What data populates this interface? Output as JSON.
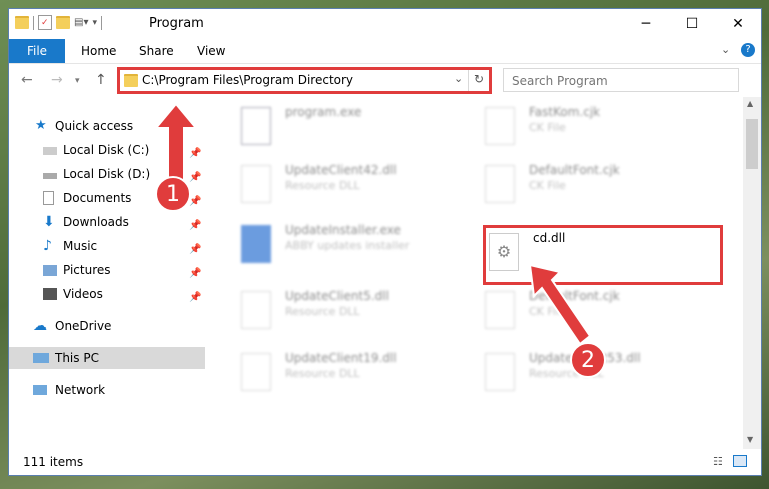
{
  "window": {
    "title": "Program",
    "minimize": "─",
    "maximize": "☐",
    "close": "✕"
  },
  "ribbon": {
    "file": "File",
    "home": "Home",
    "share": "Share",
    "view": "View"
  },
  "address": {
    "path": "C:\\Program Files\\Program Directory",
    "search_placeholder": "Search Program"
  },
  "nav": {
    "items": [
      {
        "label": "Quick access"
      },
      {
        "label": "Local Disk (C:)"
      },
      {
        "label": "Local Disk (D:)"
      },
      {
        "label": "Documents"
      },
      {
        "label": "Downloads"
      },
      {
        "label": "Music"
      },
      {
        "label": "Pictures"
      },
      {
        "label": "Videos"
      },
      {
        "label": "OneDrive"
      },
      {
        "label": "This PC"
      },
      {
        "label": "Network"
      }
    ]
  },
  "files": [
    {
      "name": "program.exe",
      "desc": ""
    },
    {
      "name": "FastKom.cjk",
      "desc": "CK File"
    },
    {
      "name": "UpdateClient42.dll",
      "desc": "Resource DLL"
    },
    {
      "name": "DefaultFont.cjk",
      "desc": "CK File"
    },
    {
      "name": "UpdateInstaller.exe",
      "desc": "ABBY updates installer"
    },
    {
      "name": "cd.dll",
      "desc": ""
    },
    {
      "name": "UpdateClient5.dll",
      "desc": "Resource DLL"
    },
    {
      "name": "DefaultFont.cjk",
      "desc": "CK File"
    },
    {
      "name": "UpdateClient19.dll",
      "desc": "Resource DLL"
    },
    {
      "name": "UpdateClient53.dll",
      "desc": "Resource DLL"
    }
  ],
  "status": {
    "count": "111 items"
  },
  "badges": {
    "one": "1",
    "two": "2"
  },
  "colors": {
    "accent": "#1979ca",
    "highlight": "#e03c3c"
  }
}
